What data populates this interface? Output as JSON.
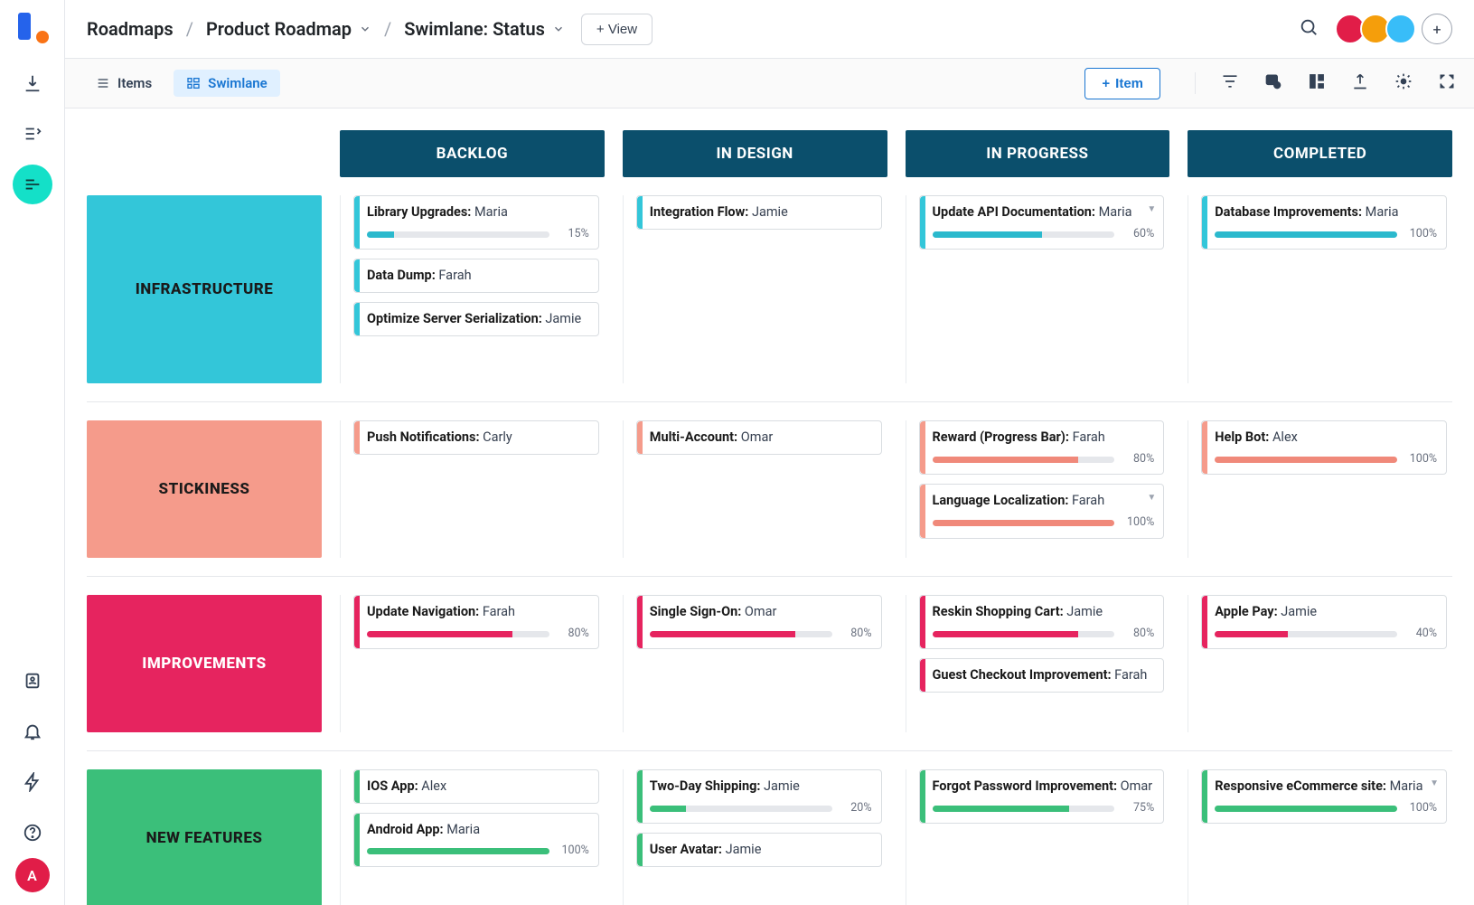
{
  "colors": {
    "infra": "#33c6d9",
    "stick": "#f59b8b",
    "improv": "#e6245f",
    "newfeat": "#3bbf7a",
    "colHeader": "#0b4f6c"
  },
  "breadcrumbs": {
    "root": "Roadmaps",
    "project": "Product Roadmap",
    "view": "Swimlane: Status"
  },
  "header": {
    "addView": "+ View"
  },
  "toolbar": {
    "items_label": "Items",
    "swimlane_label": "Swimlane",
    "add_item_label": "Item"
  },
  "columns": [
    "BACKLOG",
    "IN DESIGN",
    "IN PROGRESS",
    "COMPLETED"
  ],
  "lanes": [
    {
      "key": "infra",
      "label": "INFRASTRUCTURE",
      "columns": [
        [
          {
            "title": "Library Upgrades:",
            "assignee": "Maria",
            "progress": 15
          },
          {
            "title": "Data Dump:",
            "assignee": "Farah"
          },
          {
            "title": "Optimize Server Serialization:",
            "assignee": "Jamie"
          }
        ],
        [
          {
            "title": "Integration Flow:",
            "assignee": "Jamie"
          }
        ],
        [
          {
            "title": "Update API Documentation:",
            "assignee": "Maria",
            "progress": 60,
            "dropdown": true
          }
        ],
        [
          {
            "title": "Database Improvements:",
            "assignee": "Maria",
            "progress": 100
          }
        ]
      ]
    },
    {
      "key": "stick",
      "label": "STICKINESS",
      "columns": [
        [
          {
            "title": "Push Notifications:",
            "assignee": "Carly"
          }
        ],
        [
          {
            "title": "Multi-Account:",
            "assignee": "Omar"
          }
        ],
        [
          {
            "title": "Reward (Progress Bar):",
            "assignee": "Farah",
            "progress": 80
          },
          {
            "title": "Language Localization:",
            "assignee": "Farah",
            "progress": 100,
            "dropdown": true
          }
        ],
        [
          {
            "title": "Help Bot:",
            "assignee": "Alex",
            "progress": 100
          }
        ]
      ]
    },
    {
      "key": "improv",
      "label": "IMPROVEMENTS",
      "columns": [
        [
          {
            "title": "Update Navigation:",
            "assignee": "Farah",
            "progress": 80
          }
        ],
        [
          {
            "title": "Single Sign-On:",
            "assignee": "Omar",
            "progress": 80
          }
        ],
        [
          {
            "title": "Reskin Shopping Cart:",
            "assignee": "Jamie",
            "progress": 80
          },
          {
            "title": "Guest Checkout Improvement:",
            "assignee": "Farah"
          }
        ],
        [
          {
            "title": "Apple Pay:",
            "assignee": "Jamie",
            "progress": 40
          }
        ]
      ]
    },
    {
      "key": "newfeat",
      "label": "NEW FEATURES",
      "columns": [
        [
          {
            "title": "IOS App:",
            "assignee": "Alex"
          },
          {
            "title": "Android App: ",
            "assignee": "Maria",
            "progress": 100
          }
        ],
        [
          {
            "title": "Two-Day Shipping:",
            "assignee": "Jamie",
            "progress": 20
          },
          {
            "title": "User Avatar:",
            "assignee": "Jamie"
          }
        ],
        [
          {
            "title": "Forgot Password Improvement:",
            "assignee": "Omar",
            "progress": 75
          }
        ],
        [
          {
            "title": "Responsive eCommerce site:",
            "assignee": "Maria",
            "progress": 100,
            "dropdown": true
          }
        ]
      ]
    }
  ]
}
